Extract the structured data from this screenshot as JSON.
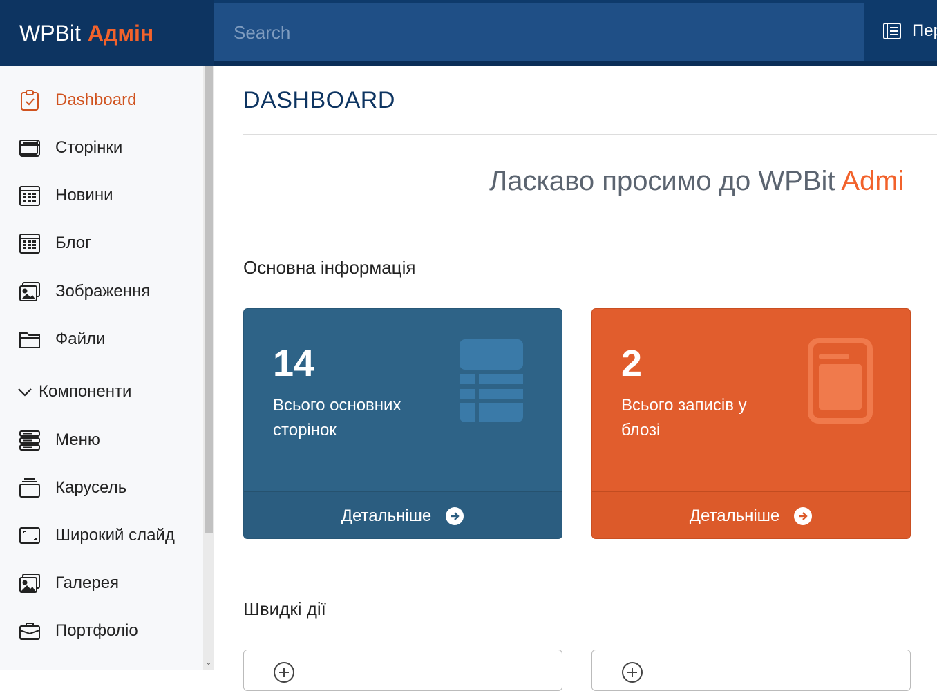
{
  "header": {
    "brand": "WPBit",
    "brand_accent": "Адмін",
    "search_placeholder": "Search",
    "right_label": "Пер"
  },
  "sidebar": {
    "items": [
      {
        "label": "Dashboard",
        "icon": "clipboard-check-icon",
        "active": true
      },
      {
        "label": "Сторінки",
        "icon": "window-icon"
      },
      {
        "label": "Новини",
        "icon": "calendar-grid-icon"
      },
      {
        "label": "Блог",
        "icon": "calendar-grid-icon"
      },
      {
        "label": "Зображення",
        "icon": "images-icon"
      },
      {
        "label": "Файли",
        "icon": "folder-icon"
      }
    ],
    "group": {
      "label": "Компоненти",
      "icon": "chevron-down-icon"
    },
    "group_items": [
      {
        "label": "Меню",
        "icon": "menu-stack-icon"
      },
      {
        "label": "Карусель",
        "icon": "carousel-icon"
      },
      {
        "label": "Широкий слайд",
        "icon": "fullscreen-icon"
      },
      {
        "label": "Галерея",
        "icon": "images-icon"
      },
      {
        "label": "Портфоліо",
        "icon": "briefcase-icon"
      }
    ]
  },
  "main": {
    "title": "DASHBOARD",
    "welcome": "Ласкаво просимо до WPBit",
    "welcome_accent": "Admi",
    "section_info": "Основна інформація",
    "section_quick": "Швидкі дії",
    "cards": [
      {
        "value": "14",
        "label": "Всього основних сторінок",
        "link": "Детальніше",
        "icon": "table-icon",
        "color": "#2e6387"
      },
      {
        "value": "2",
        "label": "Всього записів у блозі",
        "link": "Детальніше",
        "icon": "tablet-icon",
        "color": "#e15d2d"
      }
    ],
    "quick_actions": [
      {
        "icon": "plus-circle-icon"
      },
      {
        "icon": "plus-circle-icon"
      }
    ]
  }
}
